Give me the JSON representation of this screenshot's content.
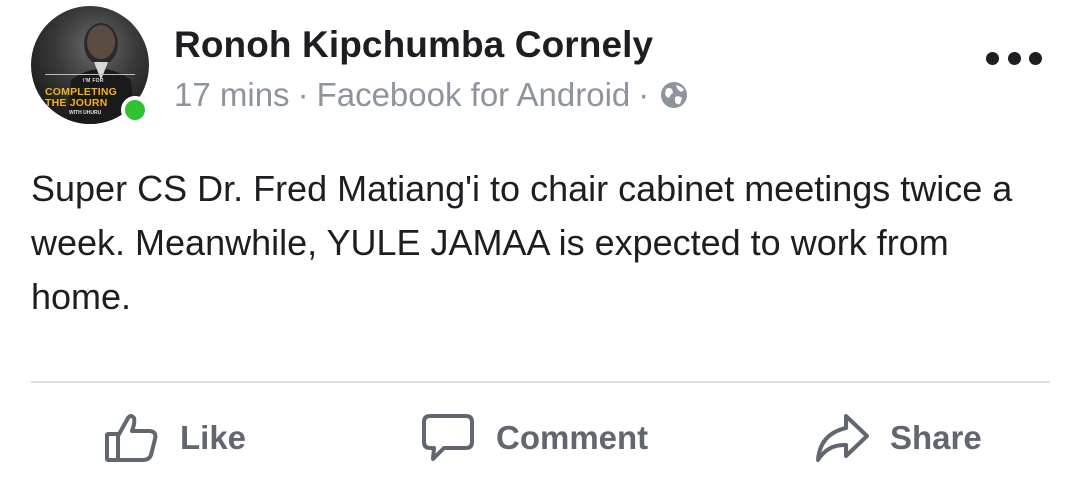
{
  "post": {
    "author": "Ronoh Kipchumba Cornely",
    "time": "17 mins",
    "source": "Facebook for Android",
    "separator": "·",
    "privacy_icon": "globe-icon",
    "text": "Super CS Dr. Fred Matiang'i to chair cabinet meetings twice a week. Meanwhile, YULE JAMAA is expected to work from home.",
    "avatar": {
      "small_top": "I'M FOR",
      "line1": "COMPLETING",
      "line2": "THE JOURN",
      "small_bottom": "WITH UHURU",
      "online": true
    }
  },
  "actions": {
    "like": "Like",
    "comment": "Comment",
    "share": "Share"
  },
  "colors": {
    "text": "#1c1e21",
    "meta": "#8d949e",
    "action": "#606770",
    "online": "#31c231",
    "divider": "#dadde1",
    "avatar_accent": "#f2b21b"
  }
}
